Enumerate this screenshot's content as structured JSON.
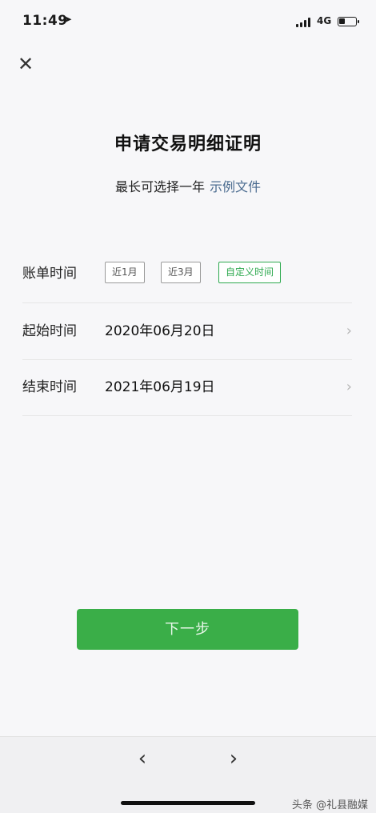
{
  "status_bar": {
    "time": "11:49",
    "network": "4G",
    "icons": [
      "location-arrow-icon",
      "signal-icon",
      "battery-icon"
    ]
  },
  "header": {
    "close_icon": "close-icon",
    "close_glyph": "✕"
  },
  "title": "申请交易明细证明",
  "subtitle": {
    "text": "最长可选择一年",
    "link": "示例文件"
  },
  "bill_time": {
    "label": "账单时间",
    "options": [
      {
        "label": "近1月",
        "selected": false
      },
      {
        "label": "近3月",
        "selected": false
      },
      {
        "label": "自定义时间",
        "selected": true
      }
    ]
  },
  "start_time": {
    "label": "起始时间",
    "value": "2020年06月20日"
  },
  "end_time": {
    "label": "结束时间",
    "value": "2021年06月19日"
  },
  "next_button": {
    "label": "下一步",
    "color": "#3aae48"
  },
  "bottom_nav": {
    "back_glyph": "‹",
    "forward_glyph": "›"
  },
  "watermark": "头条 @礼县融媒",
  "colors": {
    "accent": "#2ea94f",
    "link": "#4a6b8f",
    "background": "#f7f7f9"
  }
}
